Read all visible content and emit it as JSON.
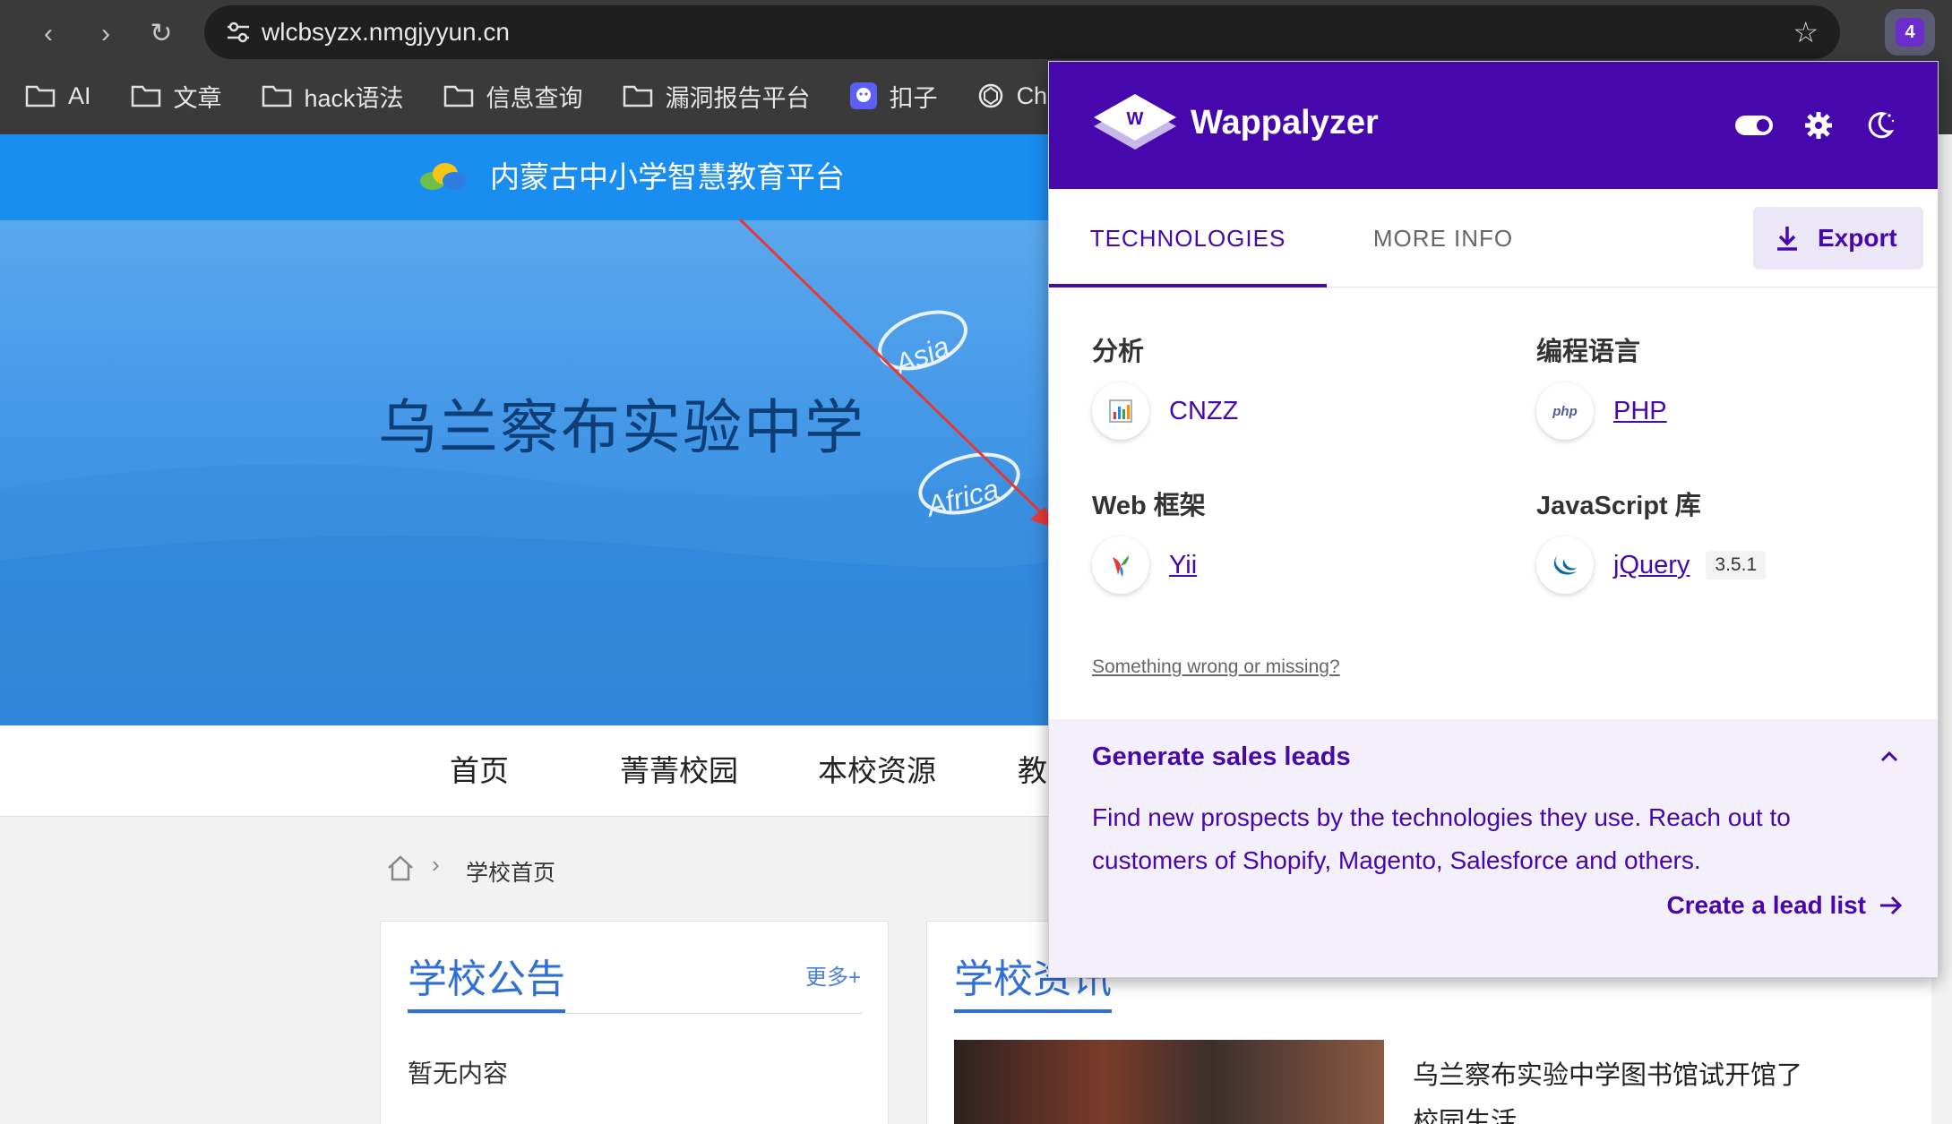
{
  "browser": {
    "url": "wlcbsyzx.nmgjyyun.cn",
    "extension_badge": "4",
    "bookmarks": [
      {
        "label": "AI",
        "icon": "folder-icon"
      },
      {
        "label": "文章",
        "icon": "folder-icon"
      },
      {
        "label": "hack语法",
        "icon": "folder-icon"
      },
      {
        "label": "信息查询",
        "icon": "folder-icon"
      },
      {
        "label": "漏洞报告平台",
        "icon": "folder-icon"
      },
      {
        "label": "扣子",
        "icon": "coze-icon"
      },
      {
        "label": "ChatGPT",
        "icon": "openai-icon"
      }
    ]
  },
  "site": {
    "platform_title": "内蒙古中小学智慧教育平台",
    "school_name": "乌兰察布实验中学",
    "nav": [
      "首页",
      "菁菁校园",
      "本校资源",
      "教"
    ],
    "breadcrumb": "学校首页",
    "notice_card": {
      "title": "学校公告",
      "more": "更多+",
      "empty": "暂无内容"
    },
    "news_card": {
      "title": "学校资讯",
      "headline": "乌兰察布实验中学图书馆试开馆了",
      "sub": "校园生活"
    },
    "hero_tags": [
      "Asia",
      "Africa"
    ]
  },
  "wappalyzer": {
    "brand": "Wappalyzer",
    "tabs": {
      "technologies": "TECHNOLOGIES",
      "more_info": "MORE INFO"
    },
    "export_label": "Export",
    "categories": [
      {
        "name": "分析",
        "tech": "CNZZ",
        "icon": "cnzz-icon"
      },
      {
        "name": "编程语言",
        "tech": "PHP",
        "icon": "php-icon"
      },
      {
        "name": "Web 框架",
        "tech": "Yii",
        "icon": "yii-icon"
      },
      {
        "name": "JavaScript 库",
        "tech": "jQuery",
        "version": "3.5.1",
        "icon": "jquery-icon"
      }
    ],
    "report_link": "Something wrong or missing?",
    "leads": {
      "title": "Generate sales leads",
      "description": "Find new prospects by the technologies they use. Reach out to customers of Shopify, Magento, Salesforce and others.",
      "cta": "Create a lead list"
    },
    "colors": {
      "brand": "#4608ad",
      "leads_bg": "#f3effb"
    }
  }
}
